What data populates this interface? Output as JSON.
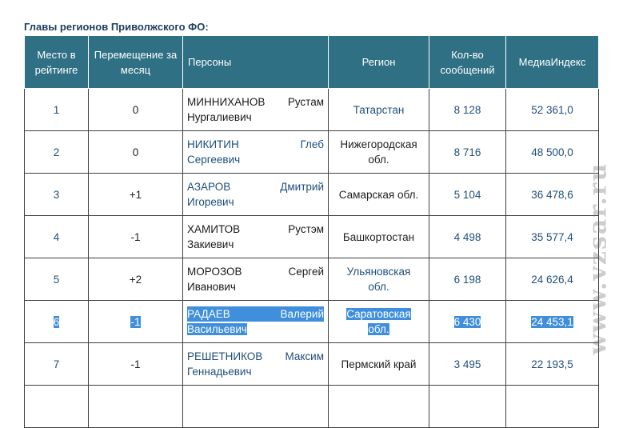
{
  "heading": "Главы регионов Приволжского ФО:",
  "columns": {
    "rank": "Место в рейтинге",
    "change": "Перемещение за месяц",
    "person": "Персоны",
    "region": "Регион",
    "messages": "Кол-во сообщений",
    "media_index": "МедиаИндекс"
  },
  "rows": [
    {
      "rank": "1",
      "change": "0",
      "surname": "МИННИХАНОВ",
      "first": "Рустам",
      "patronymic": "Нургалиевич",
      "region_l1": "Татарстан",
      "region_l2": "",
      "messages": "8 128",
      "media_index": "52 361,0"
    },
    {
      "rank": "2",
      "change": "0",
      "surname": "НИКИТИН",
      "first": "Глеб",
      "patronymic": "Сергеевич",
      "region_l1": "Нижегородская",
      "region_l2": "обл.",
      "messages": "8 716",
      "media_index": "48 500,0"
    },
    {
      "rank": "3",
      "change": "+1",
      "surname": "АЗАРОВ",
      "first": "Дмитрий",
      "patronymic": "Игоревич",
      "region_l1": "Самарская обл.",
      "region_l2": "",
      "messages": "5 104",
      "media_index": "36 478,6"
    },
    {
      "rank": "4",
      "change": "-1",
      "surname": "ХАМИТОВ",
      "first": "Рустэм",
      "patronymic": "Закиевич",
      "region_l1": "Башкортостан",
      "region_l2": "",
      "messages": "4 498",
      "media_index": "35 577,4"
    },
    {
      "rank": "5",
      "change": "+2",
      "surname": "МОРОЗОВ",
      "first": "Сергей",
      "patronymic": "Иванович",
      "region_l1": "Ульяновская",
      "region_l2": "обл.",
      "messages": "6 198",
      "media_index": "24 626,4"
    },
    {
      "rank": "6",
      "change": "-1",
      "surname": "РАДАЕВ",
      "first": "Валерий",
      "patronymic": "Васильевич",
      "region_l1": "Саратовская",
      "region_l2": "обл.",
      "messages": "6 430",
      "media_index": "24 453,1"
    },
    {
      "rank": "7",
      "change": "-1",
      "surname": "РЕШЕТНИКОВ",
      "first": "Максим",
      "patronymic": "Геннадьевич",
      "region_l1": "Пермский край",
      "region_l2": "",
      "messages": "3 495",
      "media_index": "22 193,5"
    }
  ],
  "watermark": "www.vzsar.ru",
  "colors": {
    "header_bg": "#2f7085",
    "link_blue": "#1f4f7a",
    "selection": "#3f8fdc"
  }
}
